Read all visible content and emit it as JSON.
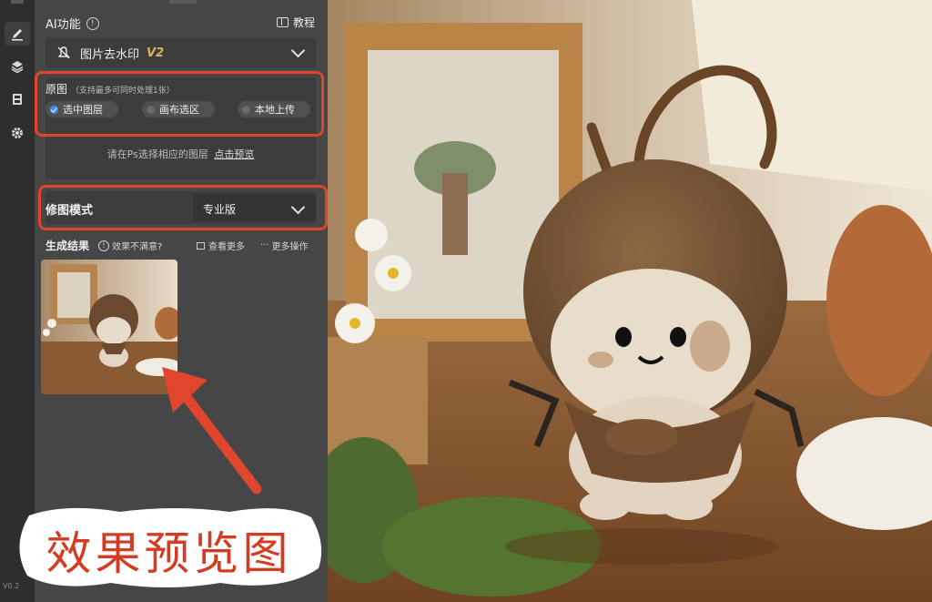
{
  "sidebar": {
    "version": "V0.2"
  },
  "panel": {
    "section_title": "AI功能",
    "tutorial_label": "教程",
    "feature": {
      "label": "图片去水印",
      "version": "V2",
      "icon": "no-watermark-icon"
    },
    "source": {
      "title": "原图",
      "note": "（支持最多可同时处理1张）",
      "options": [
        {
          "label": "选中图层",
          "checked": true
        },
        {
          "label": "画布选区",
          "checked": false
        },
        {
          "label": "本地上传",
          "checked": false
        }
      ],
      "hint": "请在Ps选择相应的图层",
      "hint_link": "点击预览"
    },
    "retouch": {
      "label": "修图模式",
      "value": "专业版"
    },
    "result": {
      "title": "生成结果",
      "unsatisfied": "效果不满意?",
      "view_more": "查看更多",
      "more_ops": "更多操作"
    }
  },
  "annotation": {
    "caption": "效果预览图",
    "color": "#e0452e"
  },
  "colors": {
    "panel_bg": "#464646",
    "accent_blue": "#3d8ef0",
    "version_gold": "#d9b85c"
  }
}
